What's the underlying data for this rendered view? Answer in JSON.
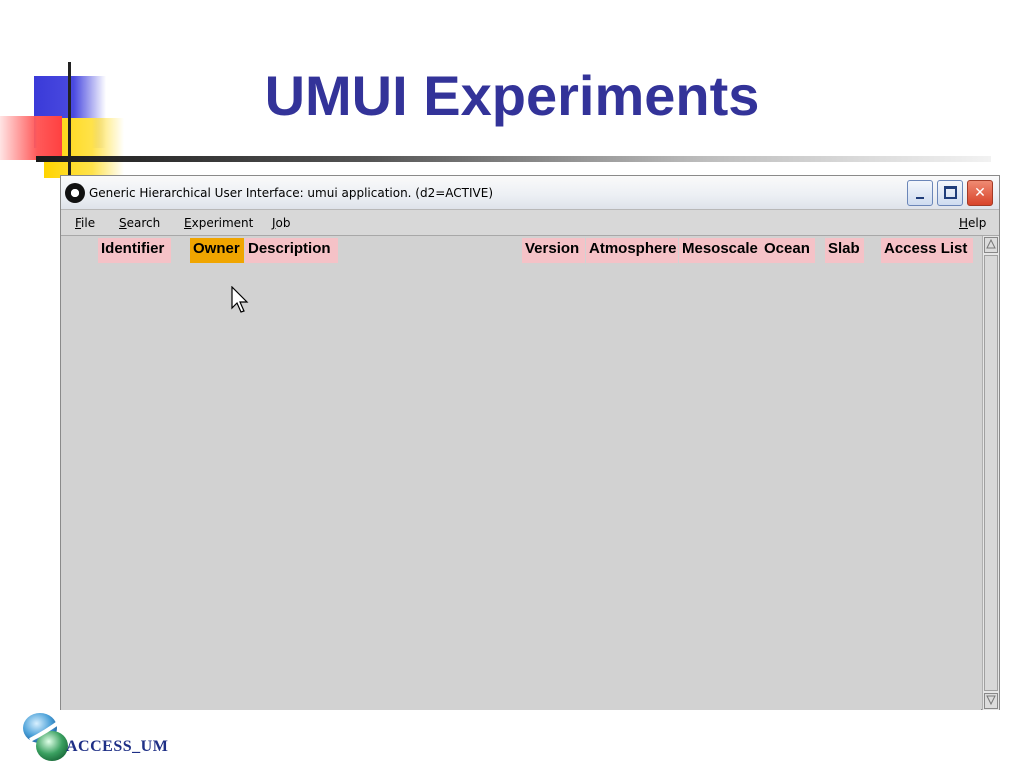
{
  "slide": {
    "title": "UMUI Experiments",
    "logo_text": "ACCESS_UM"
  },
  "window": {
    "title": "Generic Hierarchical User Interface: umui application. (d2=ACTIVE)",
    "minimize_label": "",
    "maximize_label": "",
    "close_label": "✕"
  },
  "menu": {
    "file": {
      "mnemonic": "F",
      "rest": "ile"
    },
    "search": {
      "mnemonic": "S",
      "rest": "earch"
    },
    "experiment": {
      "mnemonic": "E",
      "rest": "xperiment"
    },
    "job": {
      "mnemonic": "J",
      "rest": "ob"
    },
    "help": {
      "mnemonic": "H",
      "rest": "elp"
    }
  },
  "columns": {
    "identifier": "Identifier",
    "owner": "Owner",
    "description": "Description",
    "version": "Version",
    "atmosphere": "Atmosphere",
    "mesoscale": "Mesoscale",
    "ocean": "Ocean",
    "slab": "Slab",
    "access_list": "Access List"
  },
  "active_column": "owner",
  "colors": {
    "title": "#333399",
    "header_bg": "#f5c2c7",
    "active_header_bg": "#f0a500"
  },
  "icons": [
    "app-icon",
    "minimize-icon",
    "maximize-icon",
    "close-icon",
    "mouse-cursor-icon",
    "scroll-up-icon",
    "scroll-down-icon",
    "access-um-logo"
  ]
}
